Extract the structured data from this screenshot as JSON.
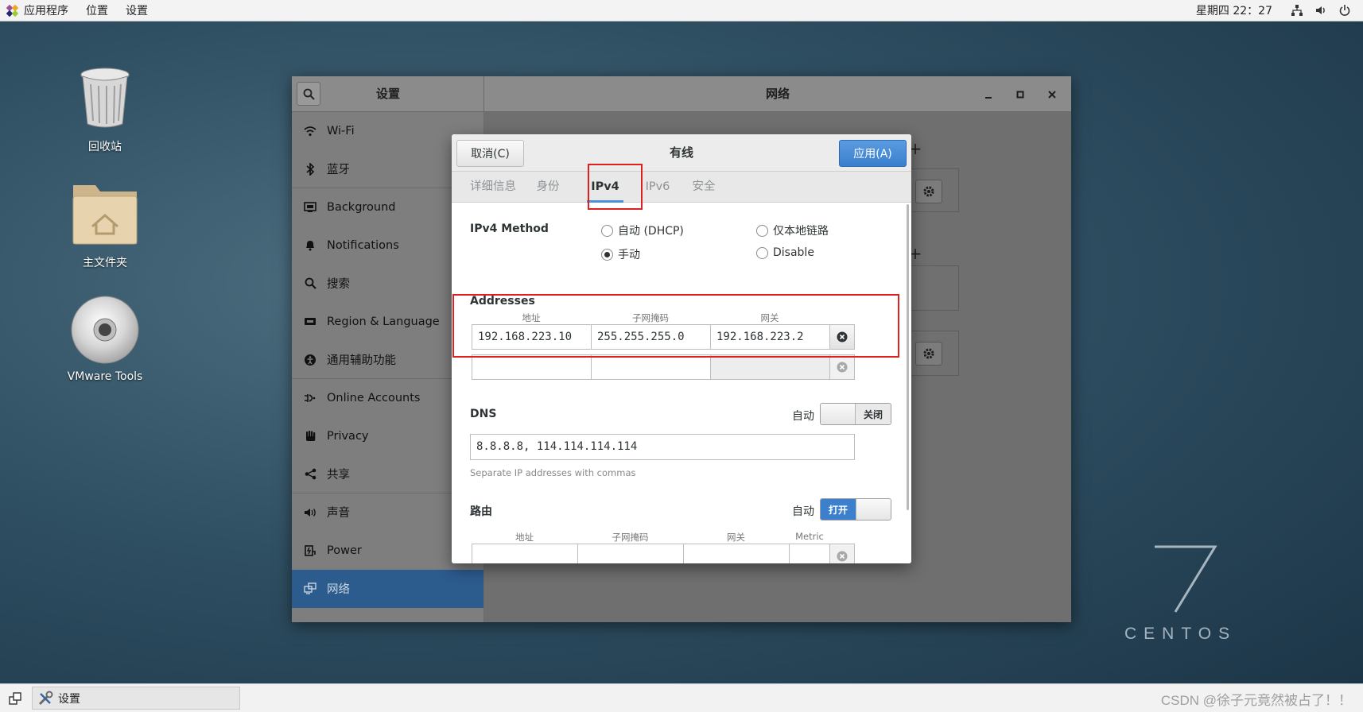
{
  "topbar": {
    "applications": "应用程序",
    "places": "位置",
    "settings": "设置",
    "clock": "星期四 22：27"
  },
  "desktop": {
    "trash_label": "回收站",
    "home_label": "主文件夹",
    "vmware_label": "VMware Tools",
    "centos_number": "7",
    "centos_word": "CENTOS"
  },
  "settings_window": {
    "left_title": "设置",
    "main_title": "网络",
    "sidebar": [
      {
        "icon": "wifi-icon",
        "label": "Wi-Fi"
      },
      {
        "icon": "bluetooth-icon",
        "label": "蓝牙"
      },
      {
        "icon": "background-icon",
        "label": "Background"
      },
      {
        "icon": "bell-icon",
        "label": "Notifications"
      },
      {
        "icon": "search-icon",
        "label": "搜索"
      },
      {
        "icon": "region-icon",
        "label": "Region & Language"
      },
      {
        "icon": "accessibility-icon",
        "label": "通用辅助功能"
      },
      {
        "icon": "online-accounts-icon",
        "label": "Online Accounts"
      },
      {
        "icon": "hand-icon",
        "label": "Privacy"
      },
      {
        "icon": "share-icon",
        "label": "共享"
      },
      {
        "icon": "speaker-icon",
        "label": "声音"
      },
      {
        "icon": "power-icon",
        "label": "Power"
      },
      {
        "icon": "network-icon",
        "label": "网络"
      }
    ]
  },
  "dialog": {
    "cancel": "取消(C)",
    "title": "有线",
    "apply": "应用(A)",
    "tabs": [
      "详细信息",
      "身份",
      "IPv4",
      "IPv6",
      "安全"
    ],
    "active_tab": "IPv4",
    "method_label": "IPv4 Method",
    "methods": {
      "auto_dhcp": "自动 (DHCP)",
      "link_local": "仅本地链路",
      "manual": "手动",
      "disable": "Disable"
    },
    "selected_method": "手动",
    "addresses": {
      "title": "Addresses",
      "headers": [
        "地址",
        "子网掩码",
        "网关"
      ],
      "rows": [
        {
          "address": "192.168.223.10",
          "netmask": "255.255.255.0",
          "gateway": "192.168.223.2"
        },
        {
          "address": "",
          "netmask": "",
          "gateway": ""
        }
      ]
    },
    "dns": {
      "title": "DNS",
      "auto_label": "自动",
      "toggle_text": "关闭",
      "value": "8.8.8.8, 114.114.114.114",
      "hint": "Separate IP addresses with commas"
    },
    "routes": {
      "title": "路由",
      "auto_label": "自动",
      "toggle_text": "打开",
      "headers": [
        "地址",
        "子网掩码",
        "网关",
        "Metric"
      ]
    }
  },
  "taskbar": {
    "item_label": "设置",
    "watermark": "CSDN @徐子元竟然被占了！！"
  },
  "colors": {
    "accent": "#4a90d9",
    "active_sidebar": "#2c5b8e",
    "annotation_red": "#e02020",
    "apply_button": "#3b7fcd"
  }
}
